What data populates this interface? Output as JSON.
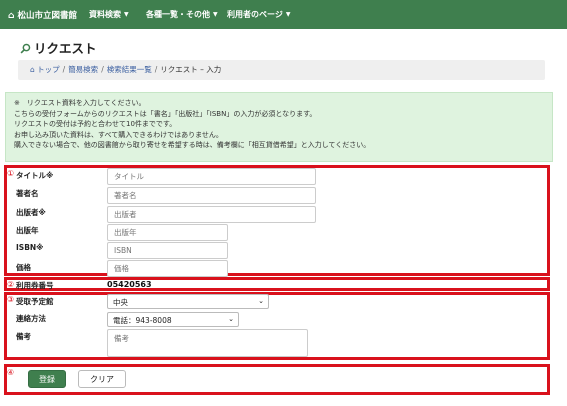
{
  "nav": {
    "brand": "松山市立図書館",
    "items": [
      "資料検索",
      "各種一覧・その他",
      "利用者のページ"
    ]
  },
  "page": {
    "title": "リクエスト"
  },
  "breadcrumb": {
    "home": "トップ",
    "items": [
      "簡易検索",
      "検索結果一覧"
    ],
    "current": "リクエスト – 入力"
  },
  "notice": {
    "lines": [
      "※　リクエスト資料を入力してください。",
      "こちらの受付フォームからのリクエストは「書名」「出版社」「ISBN」の入力が必須となります。",
      "リクエストの受付は予約と合わせて10件までです。",
      "お申し込み頂いた資料は、すべて購入できるわけではありません。",
      "購入できない場合で、他の図書館から取り寄せを希望する時は、備考欄に「相互貸借希望」と入力してください。"
    ]
  },
  "markers": [
    "①",
    "②",
    "③",
    "④"
  ],
  "form": {
    "title": {
      "label": "タイトル※",
      "placeholder": "タイトル"
    },
    "author": {
      "label": "著者名",
      "placeholder": "著者名"
    },
    "publisher": {
      "label": "出版者※",
      "placeholder": "出版者"
    },
    "year": {
      "label": "出版年",
      "placeholder": "出版年"
    },
    "isbn": {
      "label": "ISBN※",
      "placeholder": "ISBN"
    },
    "price": {
      "label": "価格",
      "placeholder": "価格"
    },
    "card": {
      "label": "利用券番号",
      "value": "05420563"
    },
    "pickup": {
      "label": "受取予定館",
      "value": "中央"
    },
    "contact": {
      "label": "連絡方法",
      "value": "電話：943-8008"
    },
    "note": {
      "label": "備考",
      "placeholder": "備考"
    }
  },
  "buttons": {
    "submit": "登録",
    "clear": "クリア"
  },
  "colors": {
    "header": "#3f7f4e",
    "highlight": "#d9111c",
    "notice_bg": "#dff3df"
  }
}
